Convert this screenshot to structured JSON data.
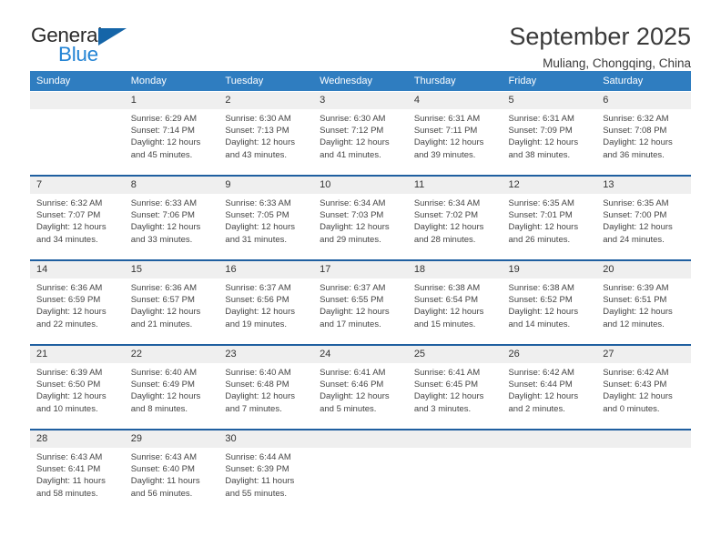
{
  "brand": {
    "name_part1": "General",
    "name_part2": "Blue",
    "triangle_icon": "triangle-icon",
    "accent_color": "#2484d4",
    "dark_color": "#2b2b2b"
  },
  "header": {
    "title": "September 2025",
    "subtitle": "Muliang, Chongqing, China"
  },
  "colors": {
    "header_blue": "#2f7dc0",
    "separator_blue": "#1f5fa0",
    "daynum_band": "#efefef"
  },
  "weekdays": [
    "Sunday",
    "Monday",
    "Tuesday",
    "Wednesday",
    "Thursday",
    "Friday",
    "Saturday"
  ],
  "weeks": [
    {
      "days": [
        {
          "num": "",
          "sunrise": "",
          "sunset": "",
          "daylight1": "",
          "daylight2": ""
        },
        {
          "num": "1",
          "sunrise": "Sunrise: 6:29 AM",
          "sunset": "Sunset: 7:14 PM",
          "daylight1": "Daylight: 12 hours",
          "daylight2": "and 45 minutes."
        },
        {
          "num": "2",
          "sunrise": "Sunrise: 6:30 AM",
          "sunset": "Sunset: 7:13 PM",
          "daylight1": "Daylight: 12 hours",
          "daylight2": "and 43 minutes."
        },
        {
          "num": "3",
          "sunrise": "Sunrise: 6:30 AM",
          "sunset": "Sunset: 7:12 PM",
          "daylight1": "Daylight: 12 hours",
          "daylight2": "and 41 minutes."
        },
        {
          "num": "4",
          "sunrise": "Sunrise: 6:31 AM",
          "sunset": "Sunset: 7:11 PM",
          "daylight1": "Daylight: 12 hours",
          "daylight2": "and 39 minutes."
        },
        {
          "num": "5",
          "sunrise": "Sunrise: 6:31 AM",
          "sunset": "Sunset: 7:09 PM",
          "daylight1": "Daylight: 12 hours",
          "daylight2": "and 38 minutes."
        },
        {
          "num": "6",
          "sunrise": "Sunrise: 6:32 AM",
          "sunset": "Sunset: 7:08 PM",
          "daylight1": "Daylight: 12 hours",
          "daylight2": "and 36 minutes."
        }
      ]
    },
    {
      "days": [
        {
          "num": "7",
          "sunrise": "Sunrise: 6:32 AM",
          "sunset": "Sunset: 7:07 PM",
          "daylight1": "Daylight: 12 hours",
          "daylight2": "and 34 minutes."
        },
        {
          "num": "8",
          "sunrise": "Sunrise: 6:33 AM",
          "sunset": "Sunset: 7:06 PM",
          "daylight1": "Daylight: 12 hours",
          "daylight2": "and 33 minutes."
        },
        {
          "num": "9",
          "sunrise": "Sunrise: 6:33 AM",
          "sunset": "Sunset: 7:05 PM",
          "daylight1": "Daylight: 12 hours",
          "daylight2": "and 31 minutes."
        },
        {
          "num": "10",
          "sunrise": "Sunrise: 6:34 AM",
          "sunset": "Sunset: 7:03 PM",
          "daylight1": "Daylight: 12 hours",
          "daylight2": "and 29 minutes."
        },
        {
          "num": "11",
          "sunrise": "Sunrise: 6:34 AM",
          "sunset": "Sunset: 7:02 PM",
          "daylight1": "Daylight: 12 hours",
          "daylight2": "and 28 minutes."
        },
        {
          "num": "12",
          "sunrise": "Sunrise: 6:35 AM",
          "sunset": "Sunset: 7:01 PM",
          "daylight1": "Daylight: 12 hours",
          "daylight2": "and 26 minutes."
        },
        {
          "num": "13",
          "sunrise": "Sunrise: 6:35 AM",
          "sunset": "Sunset: 7:00 PM",
          "daylight1": "Daylight: 12 hours",
          "daylight2": "and 24 minutes."
        }
      ]
    },
    {
      "days": [
        {
          "num": "14",
          "sunrise": "Sunrise: 6:36 AM",
          "sunset": "Sunset: 6:59 PM",
          "daylight1": "Daylight: 12 hours",
          "daylight2": "and 22 minutes."
        },
        {
          "num": "15",
          "sunrise": "Sunrise: 6:36 AM",
          "sunset": "Sunset: 6:57 PM",
          "daylight1": "Daylight: 12 hours",
          "daylight2": "and 21 minutes."
        },
        {
          "num": "16",
          "sunrise": "Sunrise: 6:37 AM",
          "sunset": "Sunset: 6:56 PM",
          "daylight1": "Daylight: 12 hours",
          "daylight2": "and 19 minutes."
        },
        {
          "num": "17",
          "sunrise": "Sunrise: 6:37 AM",
          "sunset": "Sunset: 6:55 PM",
          "daylight1": "Daylight: 12 hours",
          "daylight2": "and 17 minutes."
        },
        {
          "num": "18",
          "sunrise": "Sunrise: 6:38 AM",
          "sunset": "Sunset: 6:54 PM",
          "daylight1": "Daylight: 12 hours",
          "daylight2": "and 15 minutes."
        },
        {
          "num": "19",
          "sunrise": "Sunrise: 6:38 AM",
          "sunset": "Sunset: 6:52 PM",
          "daylight1": "Daylight: 12 hours",
          "daylight2": "and 14 minutes."
        },
        {
          "num": "20",
          "sunrise": "Sunrise: 6:39 AM",
          "sunset": "Sunset: 6:51 PM",
          "daylight1": "Daylight: 12 hours",
          "daylight2": "and 12 minutes."
        }
      ]
    },
    {
      "days": [
        {
          "num": "21",
          "sunrise": "Sunrise: 6:39 AM",
          "sunset": "Sunset: 6:50 PM",
          "daylight1": "Daylight: 12 hours",
          "daylight2": "and 10 minutes."
        },
        {
          "num": "22",
          "sunrise": "Sunrise: 6:40 AM",
          "sunset": "Sunset: 6:49 PM",
          "daylight1": "Daylight: 12 hours",
          "daylight2": "and 8 minutes."
        },
        {
          "num": "23",
          "sunrise": "Sunrise: 6:40 AM",
          "sunset": "Sunset: 6:48 PM",
          "daylight1": "Daylight: 12 hours",
          "daylight2": "and 7 minutes."
        },
        {
          "num": "24",
          "sunrise": "Sunrise: 6:41 AM",
          "sunset": "Sunset: 6:46 PM",
          "daylight1": "Daylight: 12 hours",
          "daylight2": "and 5 minutes."
        },
        {
          "num": "25",
          "sunrise": "Sunrise: 6:41 AM",
          "sunset": "Sunset: 6:45 PM",
          "daylight1": "Daylight: 12 hours",
          "daylight2": "and 3 minutes."
        },
        {
          "num": "26",
          "sunrise": "Sunrise: 6:42 AM",
          "sunset": "Sunset: 6:44 PM",
          "daylight1": "Daylight: 12 hours",
          "daylight2": "and 2 minutes."
        },
        {
          "num": "27",
          "sunrise": "Sunrise: 6:42 AM",
          "sunset": "Sunset: 6:43 PM",
          "daylight1": "Daylight: 12 hours",
          "daylight2": "and 0 minutes."
        }
      ]
    },
    {
      "days": [
        {
          "num": "28",
          "sunrise": "Sunrise: 6:43 AM",
          "sunset": "Sunset: 6:41 PM",
          "daylight1": "Daylight: 11 hours",
          "daylight2": "and 58 minutes."
        },
        {
          "num": "29",
          "sunrise": "Sunrise: 6:43 AM",
          "sunset": "Sunset: 6:40 PM",
          "daylight1": "Daylight: 11 hours",
          "daylight2": "and 56 minutes."
        },
        {
          "num": "30",
          "sunrise": "Sunrise: 6:44 AM",
          "sunset": "Sunset: 6:39 PM",
          "daylight1": "Daylight: 11 hours",
          "daylight2": "and 55 minutes."
        },
        {
          "num": "",
          "sunrise": "",
          "sunset": "",
          "daylight1": "",
          "daylight2": ""
        },
        {
          "num": "",
          "sunrise": "",
          "sunset": "",
          "daylight1": "",
          "daylight2": ""
        },
        {
          "num": "",
          "sunrise": "",
          "sunset": "",
          "daylight1": "",
          "daylight2": ""
        },
        {
          "num": "",
          "sunrise": "",
          "sunset": "",
          "daylight1": "",
          "daylight2": ""
        }
      ]
    }
  ]
}
